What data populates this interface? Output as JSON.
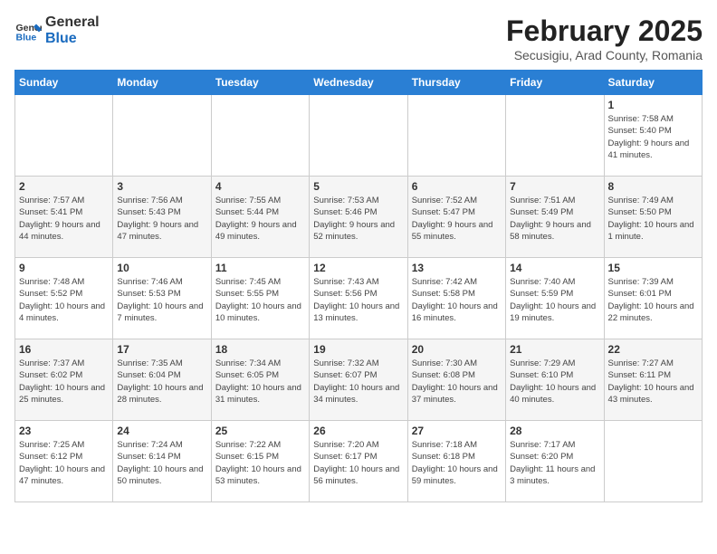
{
  "header": {
    "logo_general": "General",
    "logo_blue": "Blue",
    "title": "February 2025",
    "subtitle": "Secusigiu, Arad County, Romania"
  },
  "weekdays": [
    "Sunday",
    "Monday",
    "Tuesday",
    "Wednesday",
    "Thursday",
    "Friday",
    "Saturday"
  ],
  "weeks": [
    [
      {
        "day": "",
        "info": ""
      },
      {
        "day": "",
        "info": ""
      },
      {
        "day": "",
        "info": ""
      },
      {
        "day": "",
        "info": ""
      },
      {
        "day": "",
        "info": ""
      },
      {
        "day": "",
        "info": ""
      },
      {
        "day": "1",
        "info": "Sunrise: 7:58 AM\nSunset: 5:40 PM\nDaylight: 9 hours and 41 minutes."
      }
    ],
    [
      {
        "day": "2",
        "info": "Sunrise: 7:57 AM\nSunset: 5:41 PM\nDaylight: 9 hours and 44 minutes."
      },
      {
        "day": "3",
        "info": "Sunrise: 7:56 AM\nSunset: 5:43 PM\nDaylight: 9 hours and 47 minutes."
      },
      {
        "day": "4",
        "info": "Sunrise: 7:55 AM\nSunset: 5:44 PM\nDaylight: 9 hours and 49 minutes."
      },
      {
        "day": "5",
        "info": "Sunrise: 7:53 AM\nSunset: 5:46 PM\nDaylight: 9 hours and 52 minutes."
      },
      {
        "day": "6",
        "info": "Sunrise: 7:52 AM\nSunset: 5:47 PM\nDaylight: 9 hours and 55 minutes."
      },
      {
        "day": "7",
        "info": "Sunrise: 7:51 AM\nSunset: 5:49 PM\nDaylight: 9 hours and 58 minutes."
      },
      {
        "day": "8",
        "info": "Sunrise: 7:49 AM\nSunset: 5:50 PM\nDaylight: 10 hours and 1 minute."
      }
    ],
    [
      {
        "day": "9",
        "info": "Sunrise: 7:48 AM\nSunset: 5:52 PM\nDaylight: 10 hours and 4 minutes."
      },
      {
        "day": "10",
        "info": "Sunrise: 7:46 AM\nSunset: 5:53 PM\nDaylight: 10 hours and 7 minutes."
      },
      {
        "day": "11",
        "info": "Sunrise: 7:45 AM\nSunset: 5:55 PM\nDaylight: 10 hours and 10 minutes."
      },
      {
        "day": "12",
        "info": "Sunrise: 7:43 AM\nSunset: 5:56 PM\nDaylight: 10 hours and 13 minutes."
      },
      {
        "day": "13",
        "info": "Sunrise: 7:42 AM\nSunset: 5:58 PM\nDaylight: 10 hours and 16 minutes."
      },
      {
        "day": "14",
        "info": "Sunrise: 7:40 AM\nSunset: 5:59 PM\nDaylight: 10 hours and 19 minutes."
      },
      {
        "day": "15",
        "info": "Sunrise: 7:39 AM\nSunset: 6:01 PM\nDaylight: 10 hours and 22 minutes."
      }
    ],
    [
      {
        "day": "16",
        "info": "Sunrise: 7:37 AM\nSunset: 6:02 PM\nDaylight: 10 hours and 25 minutes."
      },
      {
        "day": "17",
        "info": "Sunrise: 7:35 AM\nSunset: 6:04 PM\nDaylight: 10 hours and 28 minutes."
      },
      {
        "day": "18",
        "info": "Sunrise: 7:34 AM\nSunset: 6:05 PM\nDaylight: 10 hours and 31 minutes."
      },
      {
        "day": "19",
        "info": "Sunrise: 7:32 AM\nSunset: 6:07 PM\nDaylight: 10 hours and 34 minutes."
      },
      {
        "day": "20",
        "info": "Sunrise: 7:30 AM\nSunset: 6:08 PM\nDaylight: 10 hours and 37 minutes."
      },
      {
        "day": "21",
        "info": "Sunrise: 7:29 AM\nSunset: 6:10 PM\nDaylight: 10 hours and 40 minutes."
      },
      {
        "day": "22",
        "info": "Sunrise: 7:27 AM\nSunset: 6:11 PM\nDaylight: 10 hours and 43 minutes."
      }
    ],
    [
      {
        "day": "23",
        "info": "Sunrise: 7:25 AM\nSunset: 6:12 PM\nDaylight: 10 hours and 47 minutes."
      },
      {
        "day": "24",
        "info": "Sunrise: 7:24 AM\nSunset: 6:14 PM\nDaylight: 10 hours and 50 minutes."
      },
      {
        "day": "25",
        "info": "Sunrise: 7:22 AM\nSunset: 6:15 PM\nDaylight: 10 hours and 53 minutes."
      },
      {
        "day": "26",
        "info": "Sunrise: 7:20 AM\nSunset: 6:17 PM\nDaylight: 10 hours and 56 minutes."
      },
      {
        "day": "27",
        "info": "Sunrise: 7:18 AM\nSunset: 6:18 PM\nDaylight: 10 hours and 59 minutes."
      },
      {
        "day": "28",
        "info": "Sunrise: 7:17 AM\nSunset: 6:20 PM\nDaylight: 11 hours and 3 minutes."
      },
      {
        "day": "",
        "info": ""
      }
    ]
  ]
}
